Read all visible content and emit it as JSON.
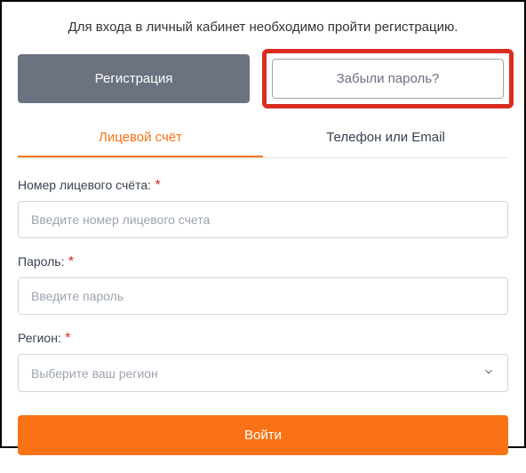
{
  "intro": "Для входа в личный кабинет необходимо пройти регистрацию.",
  "buttons": {
    "register": "Регистрация",
    "forgot": "Забыли пароль?",
    "submit": "Войти"
  },
  "tabs": {
    "account": "Лицевой счёт",
    "phone_email": "Телефон или Email"
  },
  "fields": {
    "account": {
      "label": "Номер лицевого счёта:",
      "placeholder": "Введите номер лицевого счета"
    },
    "password": {
      "label": "Пароль:",
      "placeholder": "Введите пароль"
    },
    "region": {
      "label": "Регион:",
      "placeholder": "Выберите ваш регион"
    }
  },
  "required_mark": "*"
}
